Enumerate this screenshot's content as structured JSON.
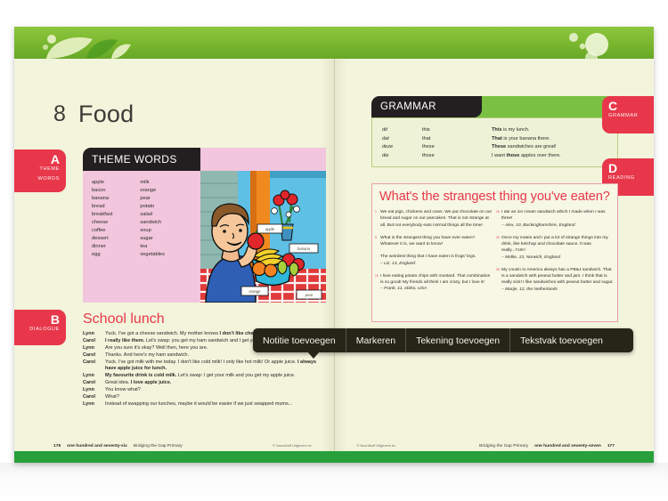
{
  "book": {
    "chapter_number": "8",
    "chapter_title": "Food"
  },
  "tabs": [
    {
      "letter": "A",
      "label": "THEME\nWORDS",
      "label_line1": "THEME",
      "label_line2": "WORDS",
      "side": "left"
    },
    {
      "letter": "B",
      "label": "DIALOGUE",
      "side": "left"
    },
    {
      "letter": "C",
      "label": "GRAMMAR",
      "side": "right"
    },
    {
      "letter": "D",
      "label": "READING",
      "side": "right"
    }
  ],
  "theme_words": {
    "header": "THEME WORDS",
    "column1": [
      "apple",
      "bacon",
      "banana",
      "bread",
      "breakfast",
      "cheese",
      "coffee",
      "dessert",
      "dinner",
      "egg"
    ],
    "column2": [
      "milk",
      "orange",
      "pear",
      "potato",
      "salad",
      "sandwich",
      "soup",
      "sugar",
      "tea",
      "vegetables"
    ]
  },
  "illustration": {
    "labels": [
      "apple",
      "banana",
      "orange",
      "pear"
    ],
    "description": "boy holding an apple beside a bowl of fruit on a chequered tablecloth"
  },
  "dialogue": {
    "title": "School lunch",
    "lines": [
      {
        "speaker": "Lynn",
        "text": "Yuck. I've got a cheese sandwich. My mother knows <b>I don't like cheese sandwiches</b>."
      },
      {
        "speaker": "Carol",
        "text": "<b>I really like them.</b> Let's swap: you get my ham sandwich and I get your cheese sandwich."
      },
      {
        "speaker": "Lynn",
        "text": "Are you sure it's okay? Well then, here you are."
      },
      {
        "speaker": "Carol",
        "text": "Thanks. And here's my ham sandwich."
      },
      {
        "speaker": "Carol",
        "text": "Yuck. I've got milk with me today. I don't like cold milk! I only like hot milk! Or apple juice. <b>I always have apple juice for lunch.</b>"
      },
      {
        "speaker": "Lynn",
        "text": "<b>My favourite drink is cold milk.</b> Let's swap: I get your milk and you get my apple juice."
      },
      {
        "speaker": "Carol",
        "text": "Great idea. <b>I love apple juice.</b>"
      },
      {
        "speaker": "Lynn",
        "text": "You know what?"
      },
      {
        "speaker": "Carol",
        "text": "What?"
      },
      {
        "speaker": "Lynn",
        "text": "Instead of swapping our lunches, maybe it would be easier if we just swapped mums..."
      }
    ]
  },
  "grammar": {
    "header": "GRAMMAR",
    "rows": [
      {
        "dutch": "dit",
        "english": "this",
        "example": "<b>This</b> is my lunch."
      },
      {
        "dutch": "dat",
        "english": "that",
        "example": "<b>That</b> is your banana there."
      },
      {
        "dutch": "deze",
        "english": "these",
        "example": "<b>These</b> sandwiches are great!"
      },
      {
        "dutch": "die",
        "english": "those",
        "example": "I want <b>those</b> apples over there."
      }
    ]
  },
  "reading": {
    "title": "What's the strangest thing you've eaten?",
    "left_column": [
      {
        "line_number": "1",
        "text": "We eat pigs, chickens and cows. We put chocolate on our bread and sugar on our pancakes. That is not strange at all. But not everybody eats normal things all the time!"
      },
      {
        "line_number": "5",
        "text": "What is the strangest thing you have ever eaten? Whatever it is, we want to know!"
      },
      {
        "line_number": "",
        "text": "The weirdest thing that I have eaten is frogs' legs.",
        "source": "– Liz, 13, England"
      },
      {
        "line_number": "10",
        "text": "I love eating potato chips with mustard. That combination is so good! My friends all think I am crazy, but I love it!",
        "source": "– Frank, 11, Idaho, USA"
      }
    ],
    "right_column": [
      {
        "line_number": "15",
        "text": "I ate an ice cream sandwich which I made when I was three!",
        "source": "– Alex, 10, Buckinghamshire, England"
      },
      {
        "line_number": "20",
        "text": "Once my mates and I put a lot of strange things into my drink, like ketchup and chocolate sauce. It was really...YUK!",
        "source": "– Mollie, 13, Norwich, England"
      },
      {
        "line_number": "25",
        "text": "My cousin in America always has a PB&J sandwich. That is a sandwich with peanut butter and jam. I think that is really sick! I like sandwiches with peanut butter and sugar.",
        "source": "– Marije, 12, the Netherlands"
      }
    ]
  },
  "footer": {
    "left_page_number": "176",
    "left_page_words": "one hundred and seventy-six",
    "left_book_title": "Bridging the Gap Primary",
    "left_copyright": "© Noordhoff Uitgevers bv",
    "right_copyright": "© Noordhoff Uitgevers bv",
    "right_book_title": "Bridging the Gap Primary",
    "right_page_words": "one hundred and seventy-seven",
    "right_page_number": "177"
  },
  "toolbar": {
    "buttons": [
      {
        "label": "Notitie toevoegen"
      },
      {
        "label": "Markeren"
      },
      {
        "label": "Tekening toevoegen"
      },
      {
        "label": "Tekstvak toevoegen"
      }
    ]
  },
  "colors": {
    "accent_red": "#e8374a",
    "banner_green": "#7ab62e",
    "bottom_bar_green": "#27a03c",
    "page_cream": "#f3f4dc",
    "theme_pink": "#f2c6dd",
    "header_black": "#231f20",
    "grammar_green": "#7ac143",
    "toolbar_dark": "#252518"
  }
}
